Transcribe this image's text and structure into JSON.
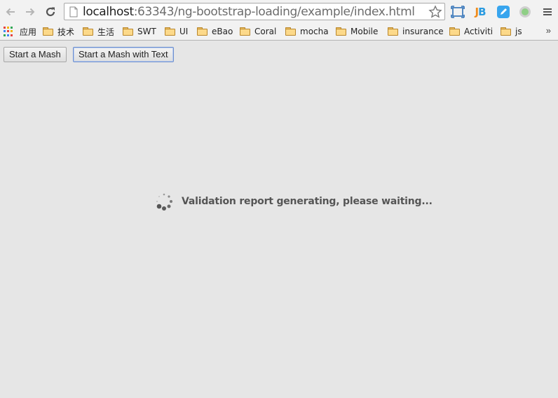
{
  "browser": {
    "url_host": "localhost",
    "url_rest": ":63343/ng-bootstrap-loading/example/index.html",
    "icons": {
      "back": "back-arrow-icon",
      "forward": "forward-arrow-icon",
      "reload": "reload-icon",
      "page": "page-icon",
      "star": "star-icon",
      "cast": "screen-icon",
      "jetbrains_j": "J",
      "jetbrains_b": "B",
      "menu": "hamburger-menu-icon"
    }
  },
  "bookmarks": {
    "apps_label": "应用",
    "items": [
      {
        "label": "技术"
      },
      {
        "label": "生活"
      },
      {
        "label": "SWT"
      },
      {
        "label": "UI"
      },
      {
        "label": "eBao"
      },
      {
        "label": "Coral"
      },
      {
        "label": "mocha"
      },
      {
        "label": "Mobile"
      },
      {
        "label": "insurance"
      },
      {
        "label": "Activiti"
      },
      {
        "label": "js"
      }
    ],
    "more": "»"
  },
  "page": {
    "buttons": {
      "start_mash": "Start a Mash",
      "start_mash_text": "Start a Mash with Text"
    },
    "loading_text": "Validation report generating, please waiting..."
  }
}
